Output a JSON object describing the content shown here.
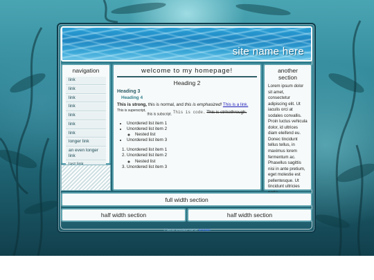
{
  "site_name": "site name here",
  "navigation": {
    "title": "navigation",
    "items": [
      "link",
      "link",
      "link",
      "link",
      "link",
      "link",
      "link",
      "longer link",
      "an even longer link",
      "last link"
    ]
  },
  "main": {
    "title": "welcome to my homepage!",
    "heading2": "Heading 2",
    "heading3": "Heading 3",
    "heading4": "Heading 4",
    "para": {
      "strong": "This is strong,",
      "normal": " this is normal, and ",
      "em": "this is emphasized!",
      "link": "This is a link.",
      "sup": "This is superscript,",
      "sub": "this is subscript.",
      "code": "This is code.",
      "strike": "This is strikethrough."
    },
    "unordered": [
      "Unordered list item 1",
      "Unordered list item 2",
      "Nested list",
      "Unordered list item 3"
    ],
    "ordered": [
      "Unordered list item 1",
      "Unordered list item 2",
      "Nested list",
      "Unordered list item 3"
    ]
  },
  "sidebar": {
    "title": "another section",
    "text": "Lorem ipsum dolor sit amet, consectetur adipiscing elit. Ut iaculis orci at sodales convallis. Proin luctus vehicula dolor, id ultrices diam eleifend eu. Donec tincidunt tellus tellus, in maximus lorem fermentum ac. Phasellus sagittis nisi in ante pretium, eget molestie est pellentesque. Ut tincidunt ultricies porta."
  },
  "full_section": "full width section",
  "half_left": "half width section",
  "half_right": "half width section",
  "footer": {
    "text": "© layout template site by ",
    "link": "template"
  },
  "colors": {
    "frame_border": "#0f3b4a",
    "panel_border": "#5aa0ad",
    "header_blue": "#1f86c2",
    "link": "#1a1ab8"
  }
}
